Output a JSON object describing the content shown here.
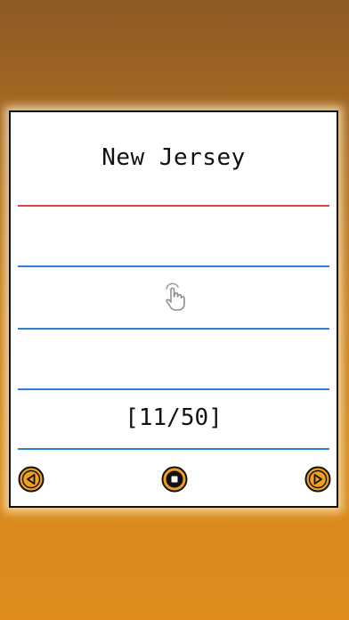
{
  "card": {
    "title": "New Jersey",
    "counter": "[11/50]"
  },
  "icons": {
    "tap": "tap-hand-icon",
    "previous": "previous-icon",
    "stop": "stop-icon",
    "next": "next-icon"
  },
  "colors": {
    "accent": "#f0a020",
    "red_rule": "#e0443e",
    "blue_rule": "#2f80d8"
  }
}
